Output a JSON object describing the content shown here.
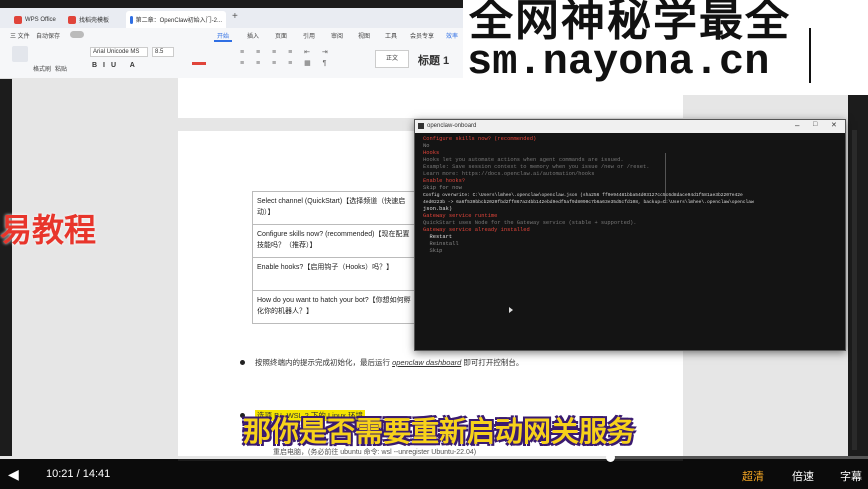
{
  "window": {
    "tabs": [
      {
        "label": "WPS Office",
        "color": "#e0443a"
      },
      {
        "label": "找稻壳模板",
        "color": "#e0443a"
      },
      {
        "label": "第二章：OpenClaw初始入门-2...",
        "color": "#2f6fe4"
      }
    ],
    "new_tab": "+"
  },
  "menubar": {
    "items": [
      "三 文件",
      "自动保存",
      "开始",
      "插入",
      "页面",
      "引用",
      "审阅",
      "视图",
      "工具",
      "会员专享",
      "效率"
    ],
    "active": "开始"
  },
  "ribbon": {
    "font_name": "Arial Unicode MS",
    "font_size": "8.5",
    "format_painter": "格式刷",
    "paste": "粘贴",
    "style_normal": "正文",
    "style_heading": "标题 1"
  },
  "watermark": {
    "line1": "全网神秘学最全",
    "line2": "sm.nayona.cn"
  },
  "left_overlay": "易教程",
  "document": {
    "table_rows": [
      "Select channel (QuickStart)【选择频道（快速启动）】",
      "Configure skills now? (recommended)【现在配置技能吗？（推荐）】",
      "Enable hooks?【启用钩子（Hooks）吗？】",
      "How do you want to hatch your bot?【你想如何孵化你的机器人？】"
    ],
    "bullet1_prefix": "按照终端内的提示完成初始化，最后运行",
    "bullet1_cmd": "openclaw dashboard",
    "bullet1_suffix": "即可打开控制台。",
    "bullet2": "选项 B：WSL 2 下的 Linux 环境",
    "bottom_text": "重启电脑，(务必前往 ubuntu 命令: wsl --unregister Ubuntu-22.04)"
  },
  "terminal": {
    "title": "openclaw-onboard",
    "lines": [
      {
        "t": "Configure skills now? (recommended)",
        "c": "#e0443a"
      },
      {
        "t": "No",
        "c": "#888"
      },
      {
        "t": "",
        "c": "#888"
      },
      {
        "t": "Hooks",
        "c": "#e0443a"
      },
      {
        "t": "",
        "c": "#888"
      },
      {
        "t": "Hooks let you automate actions when agent commands are issued.",
        "c": "#777"
      },
      {
        "t": "Example: Save session context to memory when you issue /new or /reset.",
        "c": "#777"
      },
      {
        "t": "",
        "c": "#888"
      },
      {
        "t": "Learn more: https://docs.openclaw.ai/automation/hooks",
        "c": "#777"
      },
      {
        "t": "",
        "c": "#888"
      },
      {
        "t": "Enable hooks?",
        "c": "#e0443a"
      },
      {
        "t": "Skip for now",
        "c": "#888"
      },
      {
        "t": "Config overwrite: C:\\Users\\lmhee\\.openclaw\\openclaw.json (sha256 ff0e94481bba54d03127cc5c6d8dace94d1f581ae3b2207e42e",
        "c": "#ddd"
      },
      {
        "t": "4ed0223b -> 6a6f539bbcb2020fbd2ff867a24bb142ebd9edf5af9d8090c7b6a63e35d5cfd108, backup=C:\\Users\\lmhee\\.openclaw\\openclaw",
        "c": "#ddd"
      },
      {
        "t": "json.bak)",
        "c": "#ddd"
      },
      {
        "t": "",
        "c": "#888"
      },
      {
        "t": "Gateway service runtime",
        "c": "#e0443a"
      },
      {
        "t": "",
        "c": "#888"
      },
      {
        "t": "QuickStart uses Node for the Gateway service (stable + supported).",
        "c": "#777"
      },
      {
        "t": "",
        "c": "#888"
      },
      {
        "t": "",
        "c": "#888"
      },
      {
        "t": "Gateway service already installed",
        "c": "#e0443a"
      },
      {
        "t": "  Restart",
        "c": "#ddd"
      },
      {
        "t": "  Reinstall",
        "c": "#888"
      },
      {
        "t": "  Skip",
        "c": "#888"
      }
    ]
  },
  "subtitle": {
    "part1": "那你是否需要重新启动",
    "part2": "网关服务"
  },
  "player": {
    "current_time": "10:21",
    "separator": "/",
    "total_time": "14:41",
    "progress": 0.703,
    "quality": "超清",
    "speed": "倍速",
    "captions": "字幕"
  }
}
